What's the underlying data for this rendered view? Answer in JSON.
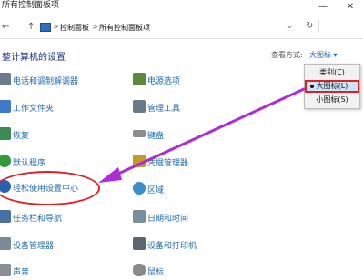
{
  "window": {
    "title": "所有控制面板项",
    "minimize_glyph": "—",
    "close_glyph": "✕"
  },
  "address": {
    "back_glyph": "←",
    "up_glyph": "↑",
    "crumbs": [
      "控制面板",
      "所有控制面板项"
    ],
    "separator": ">",
    "dropdown_glyph": "⌄",
    "refresh_glyph": "↻"
  },
  "heading": "整计算机的设置",
  "view": {
    "label": "查看方式:",
    "current": "大图标 ▾",
    "options": [
      "类别(C)",
      "大图标(L)",
      "小图标(S)"
    ],
    "selected_index": 1
  },
  "left_items": [
    {
      "label": "电话和调制解调器",
      "icon": "modem-icon",
      "color": "#6b7b8c"
    },
    {
      "label": "工作文件夹",
      "icon": "work-folder-icon",
      "color": "#3f79c9"
    },
    {
      "label": "恢复",
      "icon": "recovery-icon",
      "color": "#3e8a56"
    },
    {
      "label": "默认程序",
      "icon": "default-programs-icon",
      "color": "#2e9b3a"
    },
    {
      "label": "轻松使用设置中心",
      "icon": "ease-of-access-icon",
      "color": "#2b5fb0"
    },
    {
      "label": "任务栏和导航",
      "icon": "taskbar-icon",
      "color": "#4a6fa5"
    },
    {
      "label": "设备管理器",
      "icon": "device-manager-icon",
      "color": "#7a8a99"
    },
    {
      "label": "声音",
      "icon": "sound-icon",
      "color": "#8a8f96"
    }
  ],
  "right_items": [
    {
      "label": "电源选项",
      "icon": "power-options-icon",
      "color": "#5a8a3a"
    },
    {
      "label": "管理工具",
      "icon": "admin-tools-icon",
      "color": "#6a7a8a"
    },
    {
      "label": "键盘",
      "icon": "keyboard-icon",
      "color": "#8c8c8c"
    },
    {
      "label": "凭据管理器",
      "icon": "credential-manager-icon",
      "color": "#c49a2a"
    },
    {
      "label": "区域",
      "icon": "region-icon",
      "color": "#3c8dc9"
    },
    {
      "label": "日期和时间",
      "icon": "date-time-icon",
      "color": "#7a8f9e"
    },
    {
      "label": "设备和打印机",
      "icon": "devices-printers-icon",
      "color": "#5c6670"
    },
    {
      "label": "鼠标",
      "icon": "mouse-icon",
      "color": "#8a8a8a"
    }
  ],
  "annotation": {
    "arrow_color": "#b02bd6",
    "ellipse_color": "#e02222",
    "box_color": "#e02020"
  }
}
